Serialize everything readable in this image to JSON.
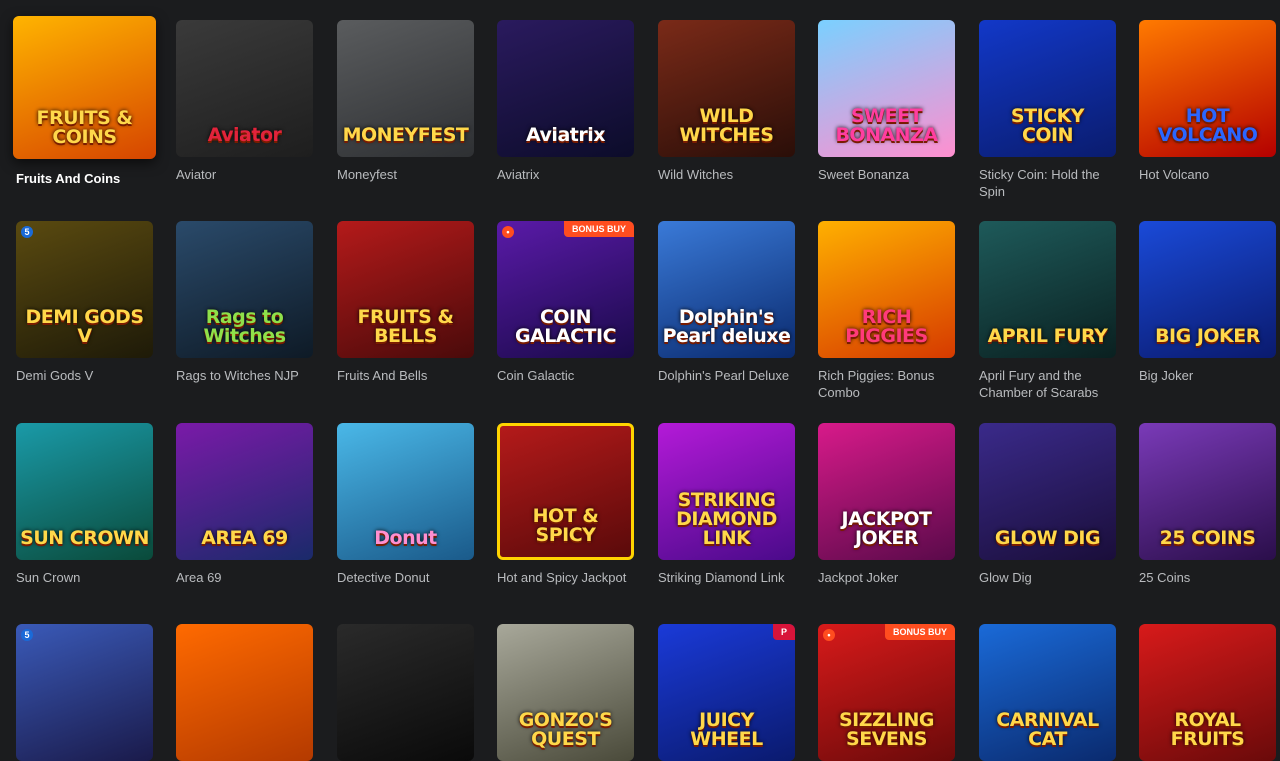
{
  "games": [
    {
      "name": "Fruits And Coins",
      "thumb_text": "FRUITS & COINS",
      "bg": "linear-gradient(160deg,#ffb400,#d64500)",
      "active": true
    },
    {
      "name": "Aviator",
      "thumb_text": "Aviator",
      "bg": "linear-gradient(160deg,#3a3a3a,#1e1e1e)",
      "text_color": "#e2233b"
    },
    {
      "name": "Moneyfest",
      "thumb_text": "MONEYFEST",
      "bg": "linear-gradient(160deg,#5a5c5e,#2e3033)"
    },
    {
      "name": "Aviatrix",
      "thumb_text": "Aviatrix",
      "bg": "linear-gradient(160deg,#2a1a5e,#0c0c2a)",
      "text_color": "#ffffff"
    },
    {
      "name": "Wild Witches",
      "thumb_text": "WILD WITCHES",
      "bg": "linear-gradient(160deg,#7a2a18,#2a0e08)"
    },
    {
      "name": "Sweet Bonanza",
      "thumb_text": "SWEET BONANZA",
      "bg": "linear-gradient(160deg,#7ad0ff,#ff8fcf)",
      "text_color": "#ff3ea0"
    },
    {
      "name": "Sticky Coin: Hold the Spin",
      "thumb_text": "STICKY COIN",
      "bg": "linear-gradient(160deg,#1238c8,#0a1c6e)"
    },
    {
      "name": "Hot Volcano",
      "thumb_text": "HOT VOLCANO",
      "bg": "linear-gradient(160deg,#ff7a00,#b40000)",
      "text_color": "#2b66ff"
    },
    {
      "name": "Demi Gods V",
      "thumb_text": "DEMI GODS V",
      "bg": "linear-gradient(160deg,#5a4a10,#1e1a08)",
      "provider": "5"
    },
    {
      "name": "Rags to Witches NJP",
      "thumb_text": "Rags to Witches",
      "bg": "linear-gradient(160deg,#2a4a6a,#0e1a26)",
      "text_color": "#8fe04a"
    },
    {
      "name": "Fruits And Bells",
      "thumb_text": "FRUITS & BELLS",
      "bg": "linear-gradient(160deg,#b41a1a,#4a0a0a)"
    },
    {
      "name": "Coin Galactic",
      "thumb_text": "COIN GALACTIC",
      "bg": "linear-gradient(160deg,#5a1aa8,#1a0a4a)",
      "text_color": "#ffffff",
      "badge": "BONUS BUY",
      "provider": "•"
    },
    {
      "name": "Dolphin's Pearl Deluxe",
      "thumb_text": "Dolphin's Pearl deluxe",
      "bg": "linear-gradient(160deg,#3a7ad8,#0a2a6e)",
      "text_color": "#ffffff"
    },
    {
      "name": "Rich Piggies: Bonus Combo",
      "thumb_text": "RICH PIGGIES",
      "bg": "linear-gradient(160deg,#ffb000,#d63a00)",
      "text_color": "#ff3a7a"
    },
    {
      "name": "April Fury and the Chamber of Scarabs",
      "thumb_text": "APRIL FURY",
      "bg": "linear-gradient(160deg,#1e5a5a,#0a2020)"
    },
    {
      "name": "Big Joker",
      "thumb_text": "BIG JOKER",
      "bg": "linear-gradient(160deg,#1a4ad8,#0a1a6e)"
    },
    {
      "name": "Sun Crown",
      "thumb_text": "SUN CROWN",
      "bg": "linear-gradient(160deg,#1a9aa8,#0a4a3a)"
    },
    {
      "name": "Area 69",
      "thumb_text": "AREA 69",
      "bg": "linear-gradient(160deg,#7a1aa8,#1a2a6a)"
    },
    {
      "name": "Detective Donut",
      "thumb_text": "Donut",
      "bg": "linear-gradient(160deg,#4ab8e8,#1a5a8a)",
      "text_color": "#ff8fd0"
    },
    {
      "name": "Hot and Spicy Jackpot",
      "thumb_text": "HOT & SPICY",
      "bg": "linear-gradient(160deg,#b41a1a,#5a0a0a)",
      "border": "#ffd400"
    },
    {
      "name": "Striking Diamond Link",
      "thumb_text": "STRIKING DIAMOND LINK",
      "bg": "linear-gradient(160deg,#b41ad8,#4a0a8a)"
    },
    {
      "name": "Jackpot Joker",
      "thumb_text": "JACKPOT JOKER",
      "bg": "linear-gradient(160deg,#d81a8a,#5a0a4a)",
      "text_color": "#ffffff"
    },
    {
      "name": "Glow Dig",
      "thumb_text": "GLOW DIG",
      "bg": "linear-gradient(160deg,#3a2a8a,#1a0e3a)"
    },
    {
      "name": "25 Coins",
      "thumb_text": "25 COINS",
      "bg": "linear-gradient(160deg,#7a3ab8,#2a0e4a)"
    },
    {
      "name": "",
      "thumb_text": "",
      "bg": "linear-gradient(160deg,#3a5ab8,#1a1a4a)",
      "provider": "5"
    },
    {
      "name": "",
      "thumb_text": "",
      "bg": "linear-gradient(160deg,#ff6a00,#b43a00)"
    },
    {
      "name": "",
      "thumb_text": "",
      "bg": "linear-gradient(160deg,#2a2a2a,#0a0a0a)"
    },
    {
      "name": "",
      "thumb_text": "GONZO'S QUEST",
      "bg": "linear-gradient(160deg,#a8a89a,#4a4a3a)"
    },
    {
      "name": "",
      "thumb_text": "JUICY WHEEL",
      "bg": "linear-gradient(160deg,#1a3ad8,#0a1a6e)",
      "badge_p": "P"
    },
    {
      "name": "",
      "thumb_text": "SIZZLING SEVENS",
      "bg": "linear-gradient(160deg,#d81a1a,#6a0a0a)",
      "badge": "BONUS BUY",
      "provider": "•"
    },
    {
      "name": "",
      "thumb_text": "CARNIVAL CAT",
      "bg": "linear-gradient(160deg,#1a6ad8,#0a2a6e)"
    },
    {
      "name": "",
      "thumb_text": "ROYAL FRUITS",
      "bg": "linear-gradient(160deg,#d81a1a,#6a0a0a)"
    }
  ]
}
